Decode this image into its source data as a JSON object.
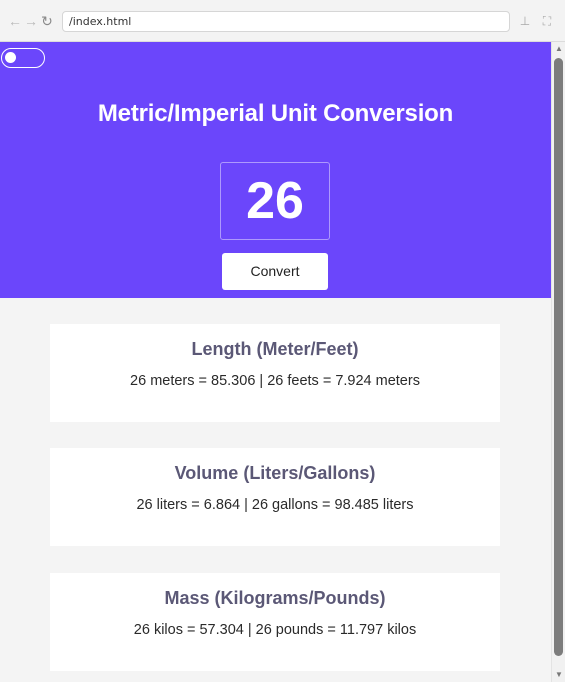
{
  "browser": {
    "url": "/index.html",
    "back_icon": "←",
    "forward_icon": "→",
    "reload_icon": "↻",
    "pin_icon": "⊥",
    "fullscreen_icon": "⛶"
  },
  "hero": {
    "title": "Metric/Imperial Unit Conversion",
    "input_value": "26",
    "convert_label": "Convert",
    "background_color": "#6b46fb"
  },
  "cards": {
    "length": {
      "title": "Length (Meter/Feet)",
      "text": "26 meters = 85.306 | 26 feets = 7.924 meters"
    },
    "volume": {
      "title": "Volume (Liters/Gallons)",
      "text": "26 liters = 6.864 | 26 gallons = 98.485 liters"
    },
    "mass": {
      "title": "Mass (Kilograms/Pounds)",
      "text": "26 kilos = 57.304 | 26 pounds = 11.797 kilos"
    }
  },
  "scrollbar": {
    "up_icon": "▲",
    "down_icon": "▼"
  }
}
